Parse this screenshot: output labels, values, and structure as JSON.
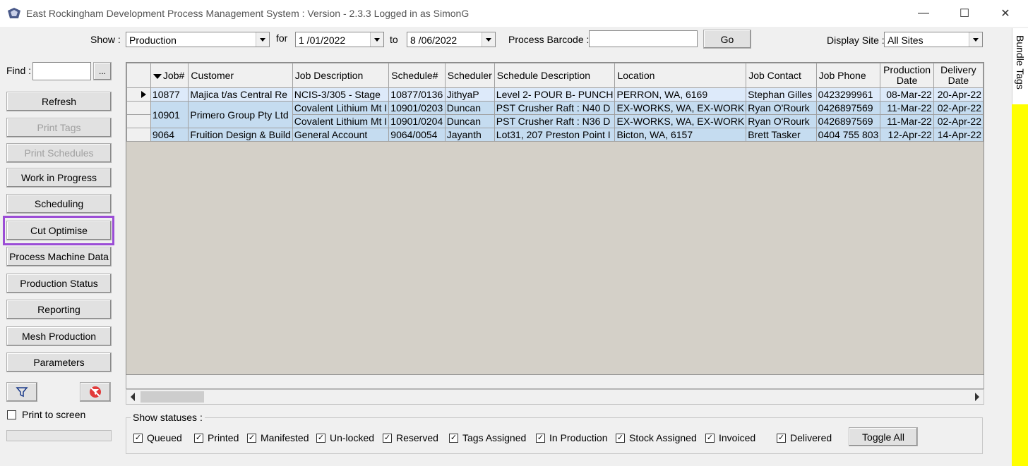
{
  "window": {
    "title": "East Rockingham Development Process Management System : Version - 2.3.3 Logged in as SimonG",
    "minimize": "—",
    "maximize": "☐",
    "close": "✕"
  },
  "toolbar": {
    "show_label": "Show :",
    "show_value": "Production",
    "for_label": "for",
    "date_from": "1 /01/2022",
    "to_label": "to",
    "date_to": "8 /06/2022",
    "barcode_label": "Process Barcode :",
    "barcode_value": "",
    "go_label": "Go",
    "site_label": "Display Site :",
    "site_value": "All Sites"
  },
  "sidebar": {
    "find_label": "Find :",
    "find_value": "",
    "find_more": "...",
    "buttons": [
      {
        "label": "Refresh",
        "enabled": true
      },
      {
        "label": "Print Tags",
        "enabled": false
      },
      {
        "label": "Print Schedules",
        "enabled": false
      },
      {
        "label": "Work in Progress",
        "enabled": true
      },
      {
        "label": "Scheduling",
        "enabled": true
      },
      {
        "label": "Cut Optimise",
        "enabled": true
      },
      {
        "label": "Process Machine Data",
        "enabled": true
      },
      {
        "label": "Production Status",
        "enabled": true
      },
      {
        "label": "Reporting",
        "enabled": true
      },
      {
        "label": "Mesh Production",
        "enabled": true
      },
      {
        "label": "Parameters",
        "enabled": true
      }
    ],
    "print_to_screen": "Print to screen",
    "highlight_color": "#9b4dd6"
  },
  "grid": {
    "columns": [
      "Job#",
      "Customer",
      "Job Description",
      "Schedule#",
      "Scheduler",
      "Schedule Description",
      "Location",
      "Job Contact",
      "Job Phone",
      "Production Date",
      "Delivery Date"
    ],
    "rows": [
      {
        "job": "10877",
        "customer": "Majica t/as Central Re",
        "desc": "NCIS-3/305 - Stage",
        "sched": "10877/0136",
        "scheduler": "JithyaP",
        "sdesc": "Level 2- POUR B- PUNCH",
        "loc": "PERRON, WA, 6169",
        "contact": "Stephan Gilles",
        "phone": "0423299961",
        "prod": "08-Mar-22",
        "deliv": "20-Apr-22"
      },
      {
        "job": "10901",
        "customer": "Primero Group Pty Ltd",
        "desc": "Covalent Lithium Mt I",
        "sched": "10901/0203",
        "scheduler": "Duncan",
        "sdesc": "PST Crusher Raft : N40 D",
        "loc": "EX-WORKS, WA, EX-WORK",
        "contact": "Ryan O'Rourk",
        "phone": "0426897569",
        "prod": "11-Mar-22",
        "deliv": "02-Apr-22"
      },
      {
        "job": "",
        "customer": "",
        "desc": "Covalent Lithium Mt I",
        "sched": "10901/0204",
        "scheduler": "Duncan",
        "sdesc": "PST Crusher Raft : N36 D",
        "loc": "EX-WORKS, WA, EX-WORK",
        "contact": "Ryan O'Rourk",
        "phone": "0426897569",
        "prod": "11-Mar-22",
        "deliv": "02-Apr-22"
      },
      {
        "job": "9064",
        "customer": "Fruition Design & Build",
        "desc": "General Account",
        "sched": "9064/0054",
        "scheduler": "Jayanth",
        "sdesc": "Lot31, 207 Preston Point I",
        "loc": "Bicton, WA, 6157",
        "contact": "Brett Tasker",
        "phone": "0404 755 803",
        "prod": "12-Apr-22",
        "deliv": "14-Apr-22"
      }
    ]
  },
  "statuses": {
    "group_label": "Show statuses :",
    "items": [
      "Queued",
      "Printed",
      "Manifested",
      "Un-locked",
      "Reserved",
      "Tags Assigned",
      "In Production",
      "Stock Assigned",
      "Invoiced",
      "Delivered"
    ],
    "toggle_label": "Toggle All"
  },
  "side_tab": {
    "label": "Bundle Tags"
  }
}
